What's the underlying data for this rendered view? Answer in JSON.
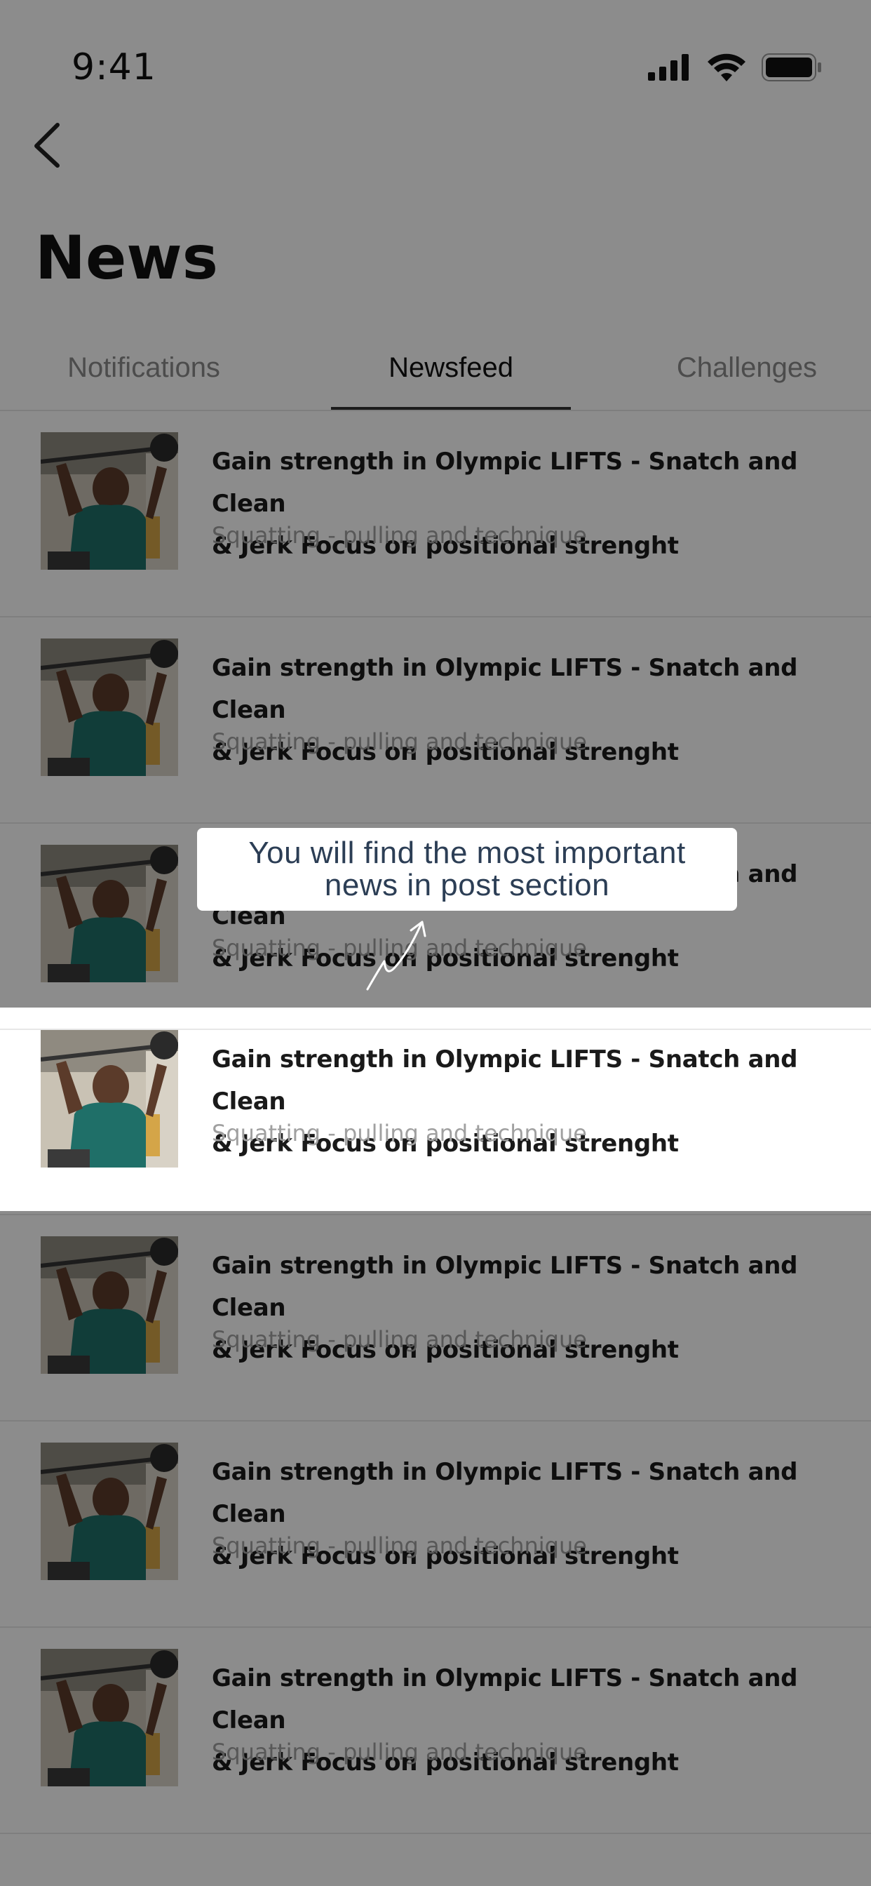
{
  "status_bar": {
    "time": "9:41",
    "icons": [
      "signal-icon",
      "wifi-icon",
      "battery-icon"
    ]
  },
  "header": {
    "back_icon": "chevron-left-icon",
    "title": "News"
  },
  "tabs": [
    {
      "label": "Notifications",
      "active": false
    },
    {
      "label": "Newsfeed",
      "active": true
    },
    {
      "label": "Challenges",
      "active": false
    }
  ],
  "news": [
    {
      "title_line1": "Gain strength in Olympic LIFTS - Snatch and Clean",
      "title_line2": "& Jerk Focus on positional strenght",
      "subtitle": "Squatting - pulling and technique"
    },
    {
      "title_line1": "Gain strength in Olympic LIFTS - Snatch and Clean",
      "title_line2": "& Jerk Focus on positional strenght",
      "subtitle": "Squatting - pulling and technique"
    },
    {
      "title_line1": "Gain strength in Olympic LIFTS - Snatch and Clean",
      "title_line2": "& Jerk Focus on positional strenght",
      "subtitle": "Squatting - pulling and technique"
    },
    {
      "title_line1": "Gain strength in Olympic LIFTS - Snatch and Clean",
      "title_line2": "& Jerk Focus on positional strenght",
      "subtitle": "Squatting - pulling and technique"
    },
    {
      "title_line1": "Gain strength in Olympic LIFTS - Snatch and Clean",
      "title_line2": "& Jerk Focus on positional strenght",
      "subtitle": "Squatting - pulling and technique"
    },
    {
      "title_line1": "Gain strength in Olympic LIFTS - Snatch and Clean",
      "title_line2": "& Jerk Focus on positional strenght",
      "subtitle": "Squatting - pulling and technique"
    },
    {
      "title_line1": "Gain strength in Olympic LIFTS - Snatch and Clean",
      "title_line2": "& Jerk Focus on positional strenght",
      "subtitle": "Squatting - pulling and technique"
    }
  ],
  "tooltip": {
    "line1": "You will find the most important",
    "line2": "news in post section"
  },
  "colors": {
    "overlay": "#000000",
    "tooltip_text": "#2c3e55",
    "title_text": "#1a1a1a",
    "subtitle_text": "#a0a0a0"
  }
}
